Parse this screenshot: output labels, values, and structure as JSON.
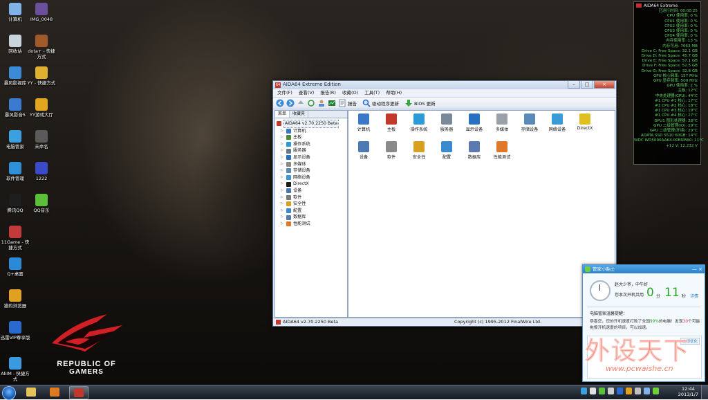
{
  "desktop": {
    "icons": [
      {
        "label": "计算机",
        "color": "#7fb2e8"
      },
      {
        "label": "IMG_0048",
        "color": "#6b4f9a"
      },
      {
        "label": "回收站",
        "color": "#c9d3db"
      },
      {
        "label": "dota+ - 快捷方式",
        "color": "#a05a2a"
      },
      {
        "label": "暴风影视库",
        "color": "#3b8ad8"
      },
      {
        "label": "YY - 快捷方式",
        "color": "#e0b030"
      },
      {
        "label": "暴风影音5",
        "color": "#3a7ad0"
      },
      {
        "label": "YY游戏大厅",
        "color": "#e3a41e"
      },
      {
        "label": "电脑管家",
        "color": "#3aa0e0"
      },
      {
        "label": "未命名",
        "color": "#5a5a5a"
      },
      {
        "label": "软件管理",
        "color": "#2d90d8"
      },
      {
        "label": "1222",
        "color": "#3a4ac8"
      },
      {
        "label": "腾讯QQ",
        "color": "#1e1e1e"
      },
      {
        "label": "QQ音乐",
        "color": "#5cbf3a"
      },
      {
        "label": "11Game - 快捷方式",
        "color": "#c43a3a"
      },
      {
        "label": "Q+桌面",
        "color": "#2a8ad8"
      },
      {
        "label": "猎豹浏览器",
        "color": "#e0a020"
      },
      {
        "label": "迅雷VIP尊享版",
        "color": "#2a6ad0"
      },
      {
        "label": "AliIM - 快捷方式",
        "color": "#3a9ae0"
      }
    ]
  },
  "rog": {
    "line1": "REPUBLIC OF",
    "line2": "GAMERS"
  },
  "sensor": {
    "title": "AIDA64 Extreme",
    "rows": [
      {
        "text": "已运行时间: 00:00:25",
        "color": "#5fd35f"
      },
      {
        "text": "CPU 使用率: 0 %",
        "color": "#5fd35f"
      },
      {
        "text": "CPU1 使用率: 0 %",
        "color": "#5fd35f"
      },
      {
        "text": "CPU2 使用率: 0 %",
        "color": "#5fd35f"
      },
      {
        "text": "CPU3 使用率: 0 %",
        "color": "#5fd35f"
      },
      {
        "text": "CPU4 使用率: 0 %",
        "color": "#5fd35f"
      },
      {
        "text": "内存使用率: 13 %",
        "color": "#5fd35f"
      },
      {
        "text": "内存可用: 7063 MB",
        "color": "#5fd35f"
      },
      {
        "text": "Drive C: Free Space: 32.1 GB",
        "color": "#5fd35f"
      },
      {
        "text": "Drive D: Free Space: 45.7 GB",
        "color": "#5fd35f"
      },
      {
        "text": "Drive E: Free Space: 57.1 GB",
        "color": "#5fd35f"
      },
      {
        "text": "Drive F: Free Space: 52.5 GB",
        "color": "#5fd35f"
      },
      {
        "text": "Drive G: Free Space: 32.8 GB",
        "color": "#5fd35f"
      },
      {
        "text": "GPU 核心频率: 157 MHz",
        "color": "#5fd35f"
      },
      {
        "text": "GPU 显存频率: 500 MHz",
        "color": "#5fd35f"
      },
      {
        "text": "GPU 使用率: 2 %",
        "color": "#5fd35f"
      },
      {
        "text": "主板: 12°C",
        "color": "#5fd35f"
      },
      {
        "text": "中央处理器(CPU): 44°C",
        "color": "#5fd35f"
      },
      {
        "text": "#1 CPU #1 核心: 17°C",
        "color": "#5fd35f"
      },
      {
        "text": "#1 CPU #2 核心: 18°C",
        "color": "#5fd35f"
      },
      {
        "text": "#1 CPU #3 核心: 19°C",
        "color": "#5fd35f"
      },
      {
        "text": "#1 CPU #4 核心: 27°C",
        "color": "#5fd35f"
      },
      {
        "text": "GPU1 图形处理器: 28°C",
        "color": "#5fd35f"
      },
      {
        "text": "GPU 二级管理(IO): 29°C",
        "color": "#5fd35f"
      },
      {
        "text": "GPU 二级管理(环境): 29°C",
        "color": "#5fd35f"
      },
      {
        "text": "ADATA SSD S510 60GB: 14°C",
        "color": "#5fd35f"
      },
      {
        "text": "WDC WD5000AAKX-00ERMA0: 11°C",
        "color": "#5fd35f"
      },
      {
        "text": "+12 V: 12.232 V",
        "color": "#5fd35f"
      }
    ]
  },
  "window": {
    "title": "AIDA64 Extreme Edition",
    "controls": {
      "min": "–",
      "max": "□",
      "close": "×"
    },
    "menu": [
      "文件(F)",
      "查看(V)",
      "报告(R)",
      "收藏(O)",
      "工具(T)",
      "帮助(H)"
    ],
    "toolbar": {
      "report": "报告",
      "driver_update": "驱动程序更新",
      "bios_update": "BIOS 更新"
    },
    "left_tabs": [
      "菜单",
      "收藏夹"
    ],
    "tree_root": "AIDA64 v2.70.2250 Beta",
    "tree": [
      {
        "label": "计算机",
        "color": "#3b78c8"
      },
      {
        "label": "主板",
        "color": "#4a8a3a"
      },
      {
        "label": "操作系统",
        "color": "#2d9ad8"
      },
      {
        "label": "服务器",
        "color": "#6a7a8a"
      },
      {
        "label": "显示设备",
        "color": "#2a70c0"
      },
      {
        "label": "多媒体",
        "color": "#8a8a8a"
      },
      {
        "label": "存储设备",
        "color": "#5a8ab8"
      },
      {
        "label": "网络设备",
        "color": "#3a9ad8"
      },
      {
        "label": "DirectX",
        "color": "#1a1a1a"
      },
      {
        "label": "设备",
        "color": "#4a7ab0"
      },
      {
        "label": "软件",
        "color": "#7a7a7a"
      },
      {
        "label": "安全性",
        "color": "#d8a020"
      },
      {
        "label": "配置",
        "color": "#3a8ad0"
      },
      {
        "label": "数据库",
        "color": "#5a7ab0"
      },
      {
        "label": "性能测试",
        "color": "#e0782a"
      }
    ],
    "grid": [
      {
        "label": "计算机",
        "color": "#3b78c8"
      },
      {
        "label": "主板",
        "color": "#c0392b"
      },
      {
        "label": "操作系统",
        "color": "#2d9ad8"
      },
      {
        "label": "服务器",
        "color": "#7a8a9a"
      },
      {
        "label": "显示设备",
        "color": "#2a70c0"
      },
      {
        "label": "多媒体",
        "color": "#9aa0a8"
      },
      {
        "label": "存储设备",
        "color": "#5a8ab8"
      },
      {
        "label": "网络设备",
        "color": "#3a9ad8"
      },
      {
        "label": "DirectX",
        "color": "#e0c020"
      },
      {
        "label": "设备",
        "color": "#4a7ab0"
      },
      {
        "label": "软件",
        "color": "#8a8a8a"
      },
      {
        "label": "安全性",
        "color": "#d8a020"
      },
      {
        "label": "配置",
        "color": "#3a8ad0"
      },
      {
        "label": "数据库",
        "color": "#5a7ab0"
      },
      {
        "label": "性能测试",
        "color": "#e0782a"
      }
    ],
    "status_left": "AIDA64 v2.70.2250 Beta",
    "status_right": "Copyright (c) 1995-2012 FinalWire Ltd."
  },
  "popup": {
    "title": "管家小贴士",
    "controls": "— ×",
    "greeting": "赵大少爷，中午好",
    "boot_label": "您本次开机共用",
    "boot_min": "0",
    "min_unit": "分",
    "boot_sec": "11",
    "sec_unit": "秒",
    "detail": "详情",
    "msg_title": "电脑管家温馨提醒：",
    "msg_pre": "恭喜您，您的开机速度打败了全国",
    "msg_pct": "99%",
    "msg_mid": "的电脑！发现",
    "msg_num": "30",
    "msg_post": "个可能拖慢开机速度的项目，可以加速。",
    "optimize": "立即优化"
  },
  "watermark": {
    "big": "外设天下",
    "url": "www.pcwaishe.cn"
  },
  "taskbar": {
    "time": "12:44",
    "date": "2013/1/7",
    "items": [
      {
        "name": "explorer",
        "color": "#e6c35a"
      },
      {
        "name": "firefox",
        "color": "#e07a20"
      },
      {
        "name": "aida64",
        "color": "#c0392b"
      }
    ],
    "tray": [
      "#3aa0e0",
      "#e0e0e0",
      "#5cbf3a",
      "#d0d0d0",
      "#2a6ad0",
      "#e0a020",
      "#c0c0c0",
      "#7fb2e8",
      "#6fce3a"
    ]
  }
}
